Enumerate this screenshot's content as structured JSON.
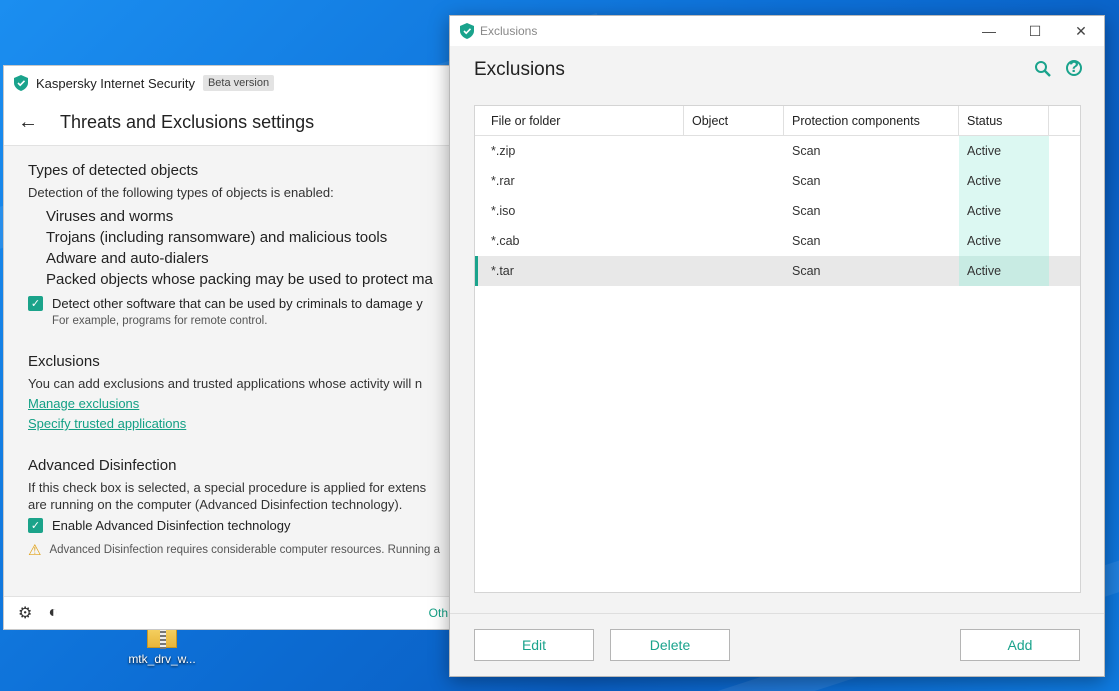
{
  "desktop": {
    "icon_label": "mtk_drv_w..."
  },
  "main_window": {
    "app_title": "Kaspersky Internet Security",
    "beta_label": "Beta version",
    "page_title": "Threats and Exclusions settings",
    "types_section": {
      "title": "Types of detected objects",
      "desc": "Detection of the following types of objects is enabled:",
      "items": [
        "Viruses and worms",
        "Trojans (including ransomware) and malicious tools",
        "Adware and auto-dialers",
        "Packed objects whose packing may be used to protect ma"
      ],
      "checkbox_label": "Detect other software that can be used by criminals to damage y",
      "checkbox_note": "For example, programs for remote control."
    },
    "exclusions_section": {
      "title": "Exclusions",
      "desc": "You can add exclusions and trusted applications whose activity will n",
      "link_manage": "Manage exclusions",
      "link_trusted": "Specify trusted applications"
    },
    "disinfection_section": {
      "title": "Advanced Disinfection",
      "desc_line1": "If this check box is selected, a special procedure is applied for extens",
      "desc_line2": "are running on the computer (Advanced Disinfection technology).",
      "checkbox_label": "Enable Advanced Disinfection technology",
      "warning": "Advanced Disinfection requires considerable computer resources. Running a"
    },
    "footer_other": "Oth"
  },
  "exclusions_dialog": {
    "window_title": "Exclusions",
    "heading": "Exclusions",
    "columns": [
      "File or folder",
      "Object",
      "Protection components",
      "Status"
    ],
    "rows": [
      {
        "file": "*.zip",
        "object": "",
        "components": "Scan",
        "status": "Active"
      },
      {
        "file": "*.rar",
        "object": "",
        "components": "Scan",
        "status": "Active"
      },
      {
        "file": "*.iso",
        "object": "",
        "components": "Scan",
        "status": "Active"
      },
      {
        "file": "*.cab",
        "object": "",
        "components": "Scan",
        "status": "Active"
      },
      {
        "file": "*.tar",
        "object": "",
        "components": "Scan",
        "status": "Active"
      }
    ],
    "buttons": {
      "edit": "Edit",
      "delete": "Delete",
      "add": "Add"
    },
    "accent_color": "#1aa38c",
    "status_bg_color": "#dcf8f2"
  }
}
